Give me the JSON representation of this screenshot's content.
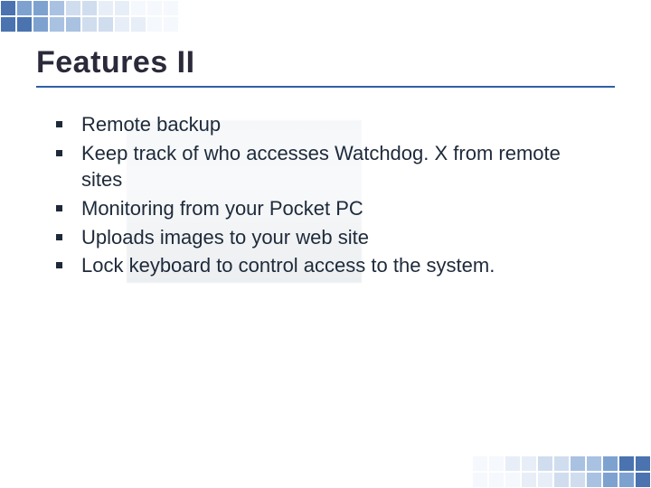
{
  "slide": {
    "title": "Features II",
    "bullets": [
      "Remote backup",
      "Keep track of who accesses Watchdog. X from remote sites",
      "Monitoring from your Pocket PC",
      "Uploads images to your web site",
      "Lock keyboard to control access to the system."
    ]
  }
}
